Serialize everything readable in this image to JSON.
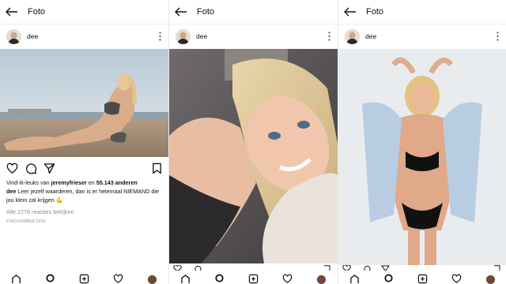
{
  "app": {
    "screen_title": "Foto"
  },
  "post": {
    "username": "dee",
    "likes": {
      "prefix": "Vind-ik-leuks van ",
      "user": "jeremyfrieser",
      "middle": " en ",
      "count": "55.143 anderen"
    },
    "caption": {
      "author": "dee",
      "text": " Leer jezelf waarderen, dan is er helemaal NIEMAND die jou klein zal krijgen",
      "emoji": "💪"
    },
    "comments_link": "Alle 2278 reacties bekijken",
    "date": "8 NOVEMBER 2015"
  },
  "icons": {
    "back": "arrow-left-icon",
    "more": "more-vertical-icon",
    "like": "heart-icon",
    "comment": "comment-icon",
    "share": "send-icon",
    "save": "bookmark-icon",
    "home": "home-icon",
    "search": "search-icon",
    "add": "add-icon",
    "activity": "heart-icon"
  },
  "colors": {
    "text": "#111111",
    "muted": "#8e8e8e",
    "background": "#ffffff"
  }
}
